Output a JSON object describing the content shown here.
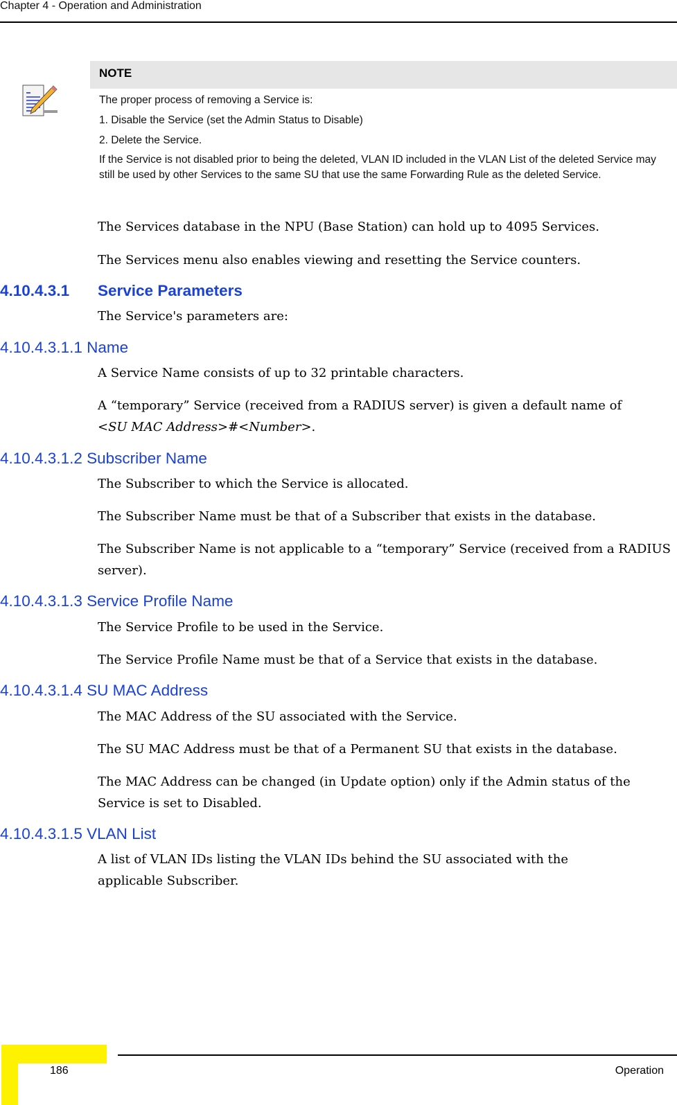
{
  "header": {
    "chapter_title": "Chapter 4 - Operation and Administration"
  },
  "note": {
    "icon": "note-pencil-icon",
    "label": "NOTE",
    "lines": [
      "The proper process of removing a Service is:",
      "1. Disable the Service (set the Admin Status to Disable)",
      "2. Delete the Service.",
      "If the Service is not disabled prior to being the deleted, VLAN ID included in the VLAN List of the deleted Service may still be used by other Services to the same SU that use the same Forwarding Rule as the deleted Service."
    ]
  },
  "intro": [
    "The Services database in the NPU (Base Station) can hold up to 4095 Services.",
    "The Services menu also enables viewing and resetting the Service counters."
  ],
  "section": {
    "number": "4.10.4.3.1",
    "title": "Service Parameters",
    "intro": "The Service's parameters are:"
  },
  "subsections": [
    {
      "number": "4.10.4.3.1.1",
      "title": "Name",
      "paragraphs": [
        "A Service Name consists of up to 32 printable characters.",
        "A “temporary” Service (received from a RADIUS server) is given a default name of"
      ],
      "italic_line": "<SU MAC Address>#<Number>",
      "italic_suffix": "."
    },
    {
      "number": "4.10.4.3.1.2",
      "title": "Subscriber Name",
      "paragraphs": [
        "The Subscriber to which the Service is allocated.",
        "The Subscriber Name must be that of a Subscriber that exists in the database.",
        "The Subscriber Name is not applicable to a “temporary” Service (received from a RADIUS server)."
      ]
    },
    {
      "number": "4.10.4.3.1.3",
      "title": "Service Profile Name",
      "paragraphs": [
        "The Service Profile to be used in the Service.",
        "The Service Profile Name must be that of a Service that exists in the database."
      ]
    },
    {
      "number": "4.10.4.3.1.4",
      "title": "SU MAC Address",
      "paragraphs": [
        "The MAC Address of the SU associated with the Service.",
        "The SU MAC Address must be that of a Permanent SU that exists in the database.",
        "The MAC Address can be changed (in Update option) only if the Admin status of the Service is set to Disabled."
      ]
    },
    {
      "number": "4.10.4.3.1.5",
      "title": "VLAN List",
      "paragraphs": [
        "A list of VLAN IDs listing the VLAN IDs behind the SU associated with the applicable Subscriber."
      ]
    }
  ],
  "footer": {
    "page_number": "186",
    "section_name": "Operation",
    "accent_color": "#fff200"
  },
  "colors": {
    "heading": "#1a41d6",
    "note_bg": "#e6e6e6"
  }
}
